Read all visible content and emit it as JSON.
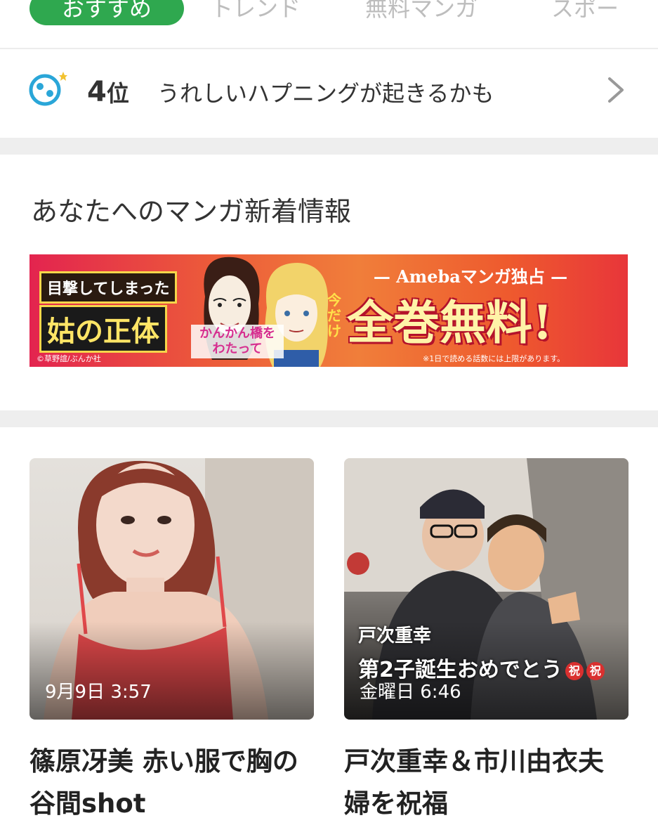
{
  "tabs": [
    {
      "label": "おすすめ",
      "active": true
    },
    {
      "label": "トレンド",
      "active": false
    },
    {
      "label": "無料マンガ",
      "active": false
    },
    {
      "label": "スポー",
      "active": false
    }
  ],
  "horoscope": {
    "icon": "cancer-zodiac-icon",
    "rank_number": "4",
    "rank_unit": "位",
    "message": "うれしいハプニングが起きるかも"
  },
  "manga_section": {
    "title": "あなたへのマンガ新着情報",
    "banner": {
      "line1": "目撃してしまった",
      "line2": "姑の正体",
      "subtitle": "かんかん橋をわたって",
      "tagline": "— Amebaマンガ独占 —",
      "limited": "今だけ",
      "headline": "全巻無料!",
      "copyright": "©草野誼/ぶんか社",
      "note": "※1日で読める話数には上限があります。"
    }
  },
  "news": [
    {
      "time": "9月9日 3:57",
      "caption_name": "",
      "caption_text": "",
      "title": "篠原冴美 赤い服で胸の谷間shot"
    },
    {
      "time": "金曜日 6:46",
      "caption_name": "戸次重幸",
      "caption_text": "第2子誕生おめでとう",
      "badge1": "祝",
      "badge2": "祝",
      "title": "戸次重幸＆市川由衣夫婦を祝福"
    }
  ],
  "colors": {
    "accent_green": "#2fa84f",
    "banner_red": "#e3244f",
    "badge_red": "#d9302f"
  }
}
